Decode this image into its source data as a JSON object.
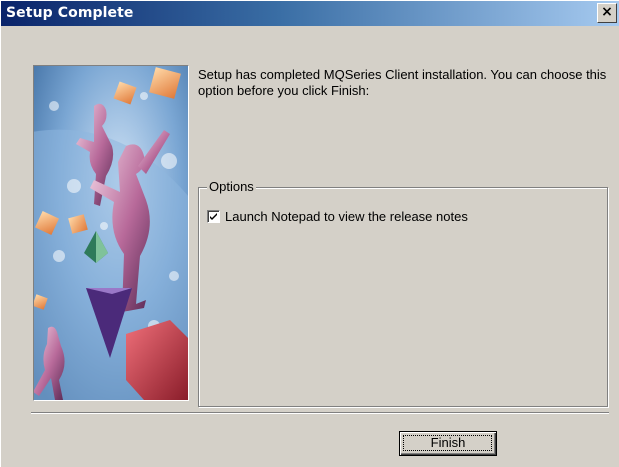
{
  "window": {
    "title": "Setup Complete",
    "close_glyph": "✕",
    "close_icon": "close-icon"
  },
  "main": {
    "message": "Setup has completed MQSeries Client installation. You can choose this option before you click Finish:"
  },
  "options": {
    "group_label": "Options",
    "launch_notepad": {
      "label": "Launch Notepad to view the release notes",
      "checked": true
    }
  },
  "buttons": {
    "finish_label": "Finish"
  },
  "colors": {
    "title_bar_start": "#0a246a",
    "title_bar_end": "#a6caf0",
    "dialog_background": "#d4d0c8"
  }
}
